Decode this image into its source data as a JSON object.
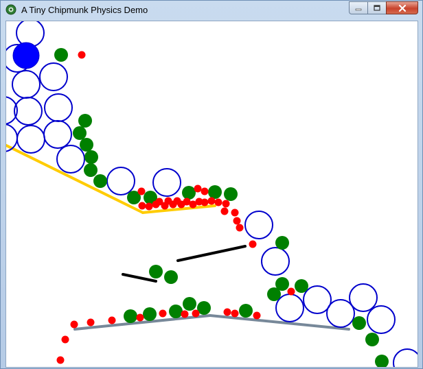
{
  "window": {
    "title": "A Tiny Chipmunk Physics Demo",
    "app_icon": "chipmunk-icon",
    "controls": {
      "minimize_icon": "minimize-icon",
      "maximize_icon": "maximize-icon",
      "close_icon": "close-icon"
    }
  },
  "colors": {
    "titlebar": "#bcd0e8",
    "canvas_background": "#ffffff",
    "large_ball_outline": "#0000cc",
    "selected_ball_fill": "#0000ff",
    "medium_ball_fill": "#008000",
    "small_ball_fill": "#ff0000",
    "ramp_segment": "#ffcc00",
    "floor_segment": "#778899",
    "black_segment": "#000000"
  }
}
